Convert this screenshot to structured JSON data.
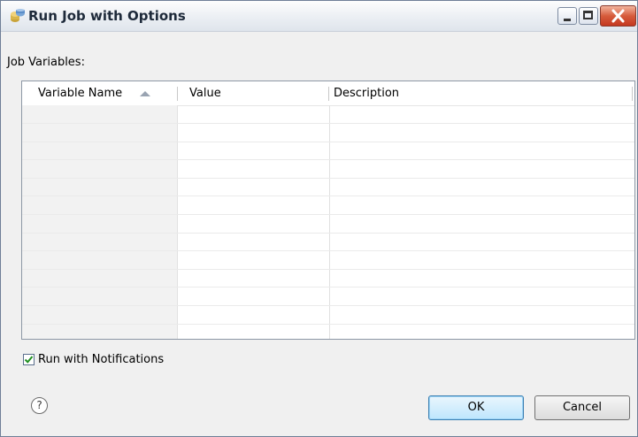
{
  "window": {
    "title": "Run Job with Options",
    "icon": "job-icon",
    "controls": [
      "minimize-icon",
      "maximize-icon",
      "close-icon"
    ]
  },
  "variables_section": {
    "label": "Job Variables:"
  },
  "table": {
    "columns": [
      {
        "label": "Variable Name",
        "sorted": "ascending"
      },
      {
        "label": "Value"
      },
      {
        "label": "Description"
      }
    ],
    "rows": []
  },
  "notifications": {
    "label": "Run with Notifications",
    "checked": true
  },
  "footer": {
    "help_icon": "help-icon",
    "help_glyph": "?",
    "ok_label": "OK",
    "cancel_label": "Cancel"
  },
  "colors": {
    "title_text": "#1e2a3a",
    "close_button": "#c4381f",
    "checkbox_check": "#1f8f1f"
  }
}
